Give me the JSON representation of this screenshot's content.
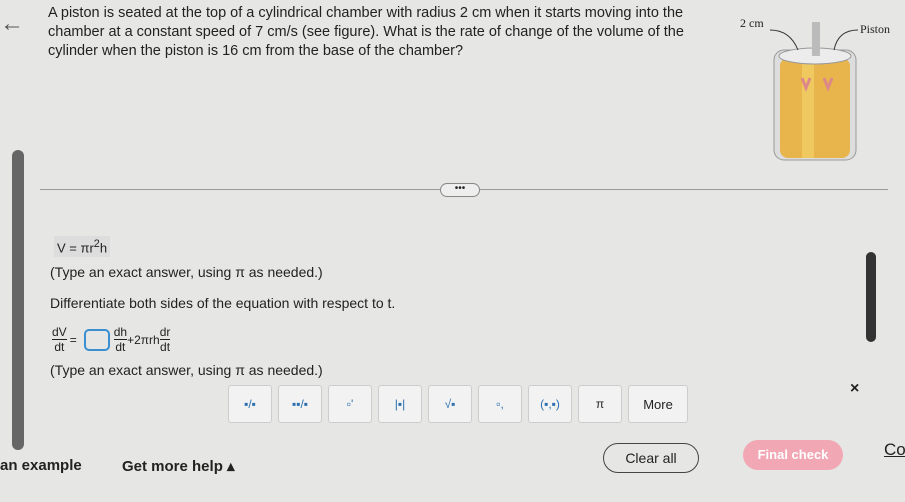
{
  "question": "A piston is seated at the top of a cylindrical chamber with radius 2 cm when it starts moving into the chamber at a constant speed of 7 cm/s (see figure). What is the rate of change of the volume of the cylinder when the piston is 16 cm from the base of the chamber?",
  "figure": {
    "radius_label": "2 cm",
    "piston_label": "Piston"
  },
  "more_dots": "•••",
  "formula": {
    "lhs": "V = πr",
    "exp": "2",
    "rhs": "h"
  },
  "hint1": "(Type an exact answer, using π as needed.)",
  "instruction": "Differentiate both sides of the equation with respect to t.",
  "derivative": {
    "dV": "dV",
    "dt": "dt",
    "eq": "=",
    "dh": "dh",
    "plus_term": "+2πrh",
    "dr": "dr"
  },
  "hint2": "(Type an exact answer, using π as needed.)",
  "toolbar": [
    "fraction",
    "mixed number",
    "exponent",
    "absolute value",
    "sqrt",
    "subscript",
    "(■,■)",
    "π",
    "More"
  ],
  "toolbar_glyphs": [
    "▪/▪",
    "▪▪/▪",
    "▫'",
    "|▪|",
    "√▪",
    "▫,",
    "(▪,▪)",
    "π",
    "More"
  ],
  "close": "×",
  "footer": {
    "example": "an example",
    "help": "Get more help ▴",
    "clear": "Clear all",
    "final": "Final check",
    "cut": "Co"
  },
  "colors": {
    "final_check": "#f1a7b4",
    "input_border": "#3a8fd0"
  }
}
